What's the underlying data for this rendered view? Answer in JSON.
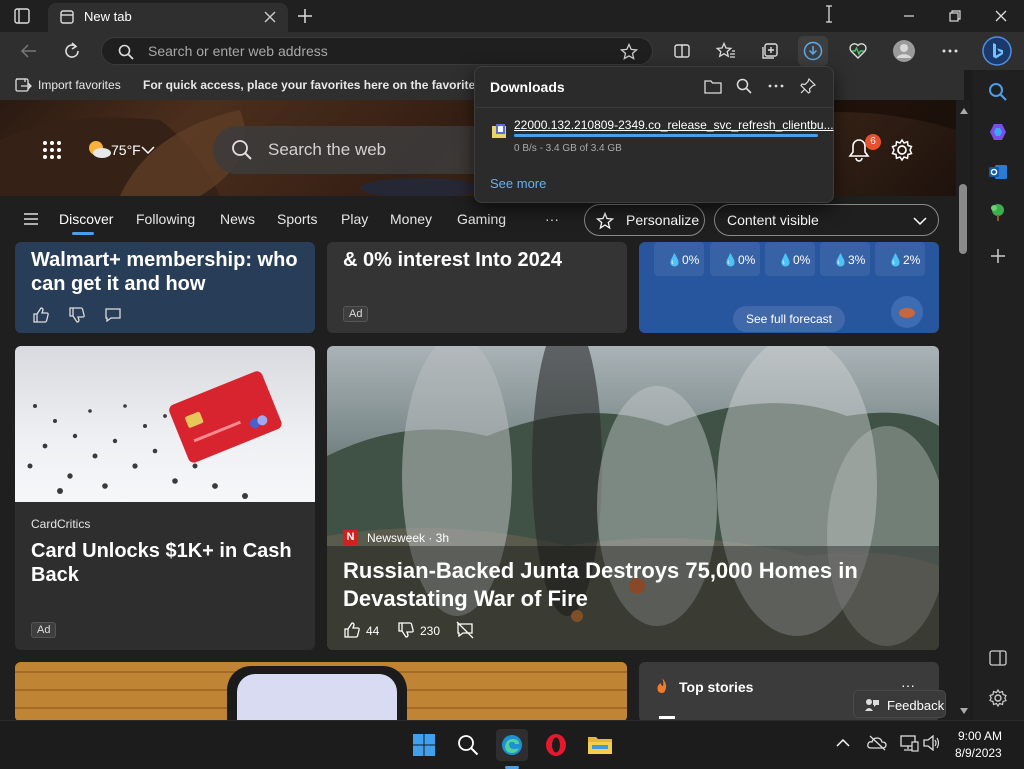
{
  "browser": {
    "tab_title": "New tab",
    "address_placeholder": "Search or enter web address",
    "import_favorites": "Import favorites",
    "favorites_hint": "For quick access, place your favorites here on the favorites ba"
  },
  "downloads": {
    "title": "Downloads",
    "file_name": "22000.132.210809-2349.co_release_svc_refresh_clientbu...",
    "progress_text": "0 B/s - 3.4 GB of 3.4 GB",
    "progress_fraction": 1.0,
    "see_more": "See more"
  },
  "page": {
    "weather_temp": "75°F",
    "search_placeholder": "Search the web",
    "notification_count": "6",
    "nav": [
      "Discover",
      "Following",
      "News",
      "Sports",
      "Play",
      "Money",
      "Gaming",
      "···"
    ],
    "personalize": "Personalize",
    "content_visible": "Content visible"
  },
  "cards": {
    "walmart_headline": "Walmart+ membership: who can get it and how",
    "finance_headline": "& 0% interest Into 2024",
    "ad_label": "Ad",
    "forecast_precip": [
      "0%",
      "0%",
      "0%",
      "3%",
      "2%"
    ],
    "see_full_forecast": "See full forecast",
    "cardcritics_source": "CardCritics",
    "cardcritics_headline": "Card Unlocks $1K+ in Cash Back",
    "news_source": "Newsweek · 3h",
    "news_headline": "Russian-Backed Junta Destroys 75,000 Homes in Devastating War of Fire",
    "likes": "44",
    "dislikes": "230",
    "top_stories": "Top stories",
    "more": "···",
    "feedback": "Feedback"
  },
  "taskbar": {
    "time": "9:00 AM",
    "date": "8/9/2023"
  },
  "colors": {
    "accent_blue": "#4a9eea",
    "notification_red": "#e8512e",
    "weather_card_blue": "#27559e"
  }
}
